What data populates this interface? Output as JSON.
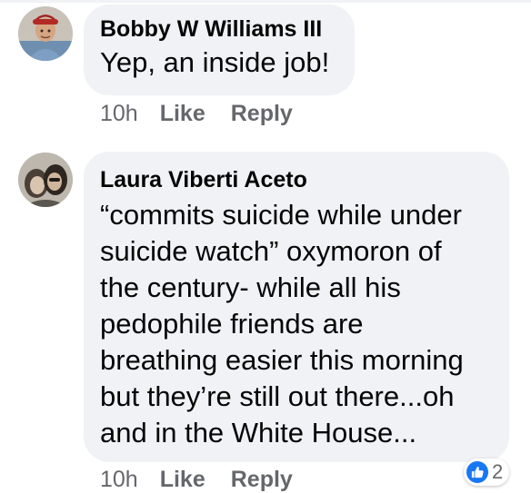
{
  "comments": [
    {
      "author": "Bobby W Williams III",
      "text": "Yep, an inside job!",
      "time": "10h",
      "like_label": "Like",
      "reply_label": "Reply",
      "avatar": "avatar-photo-man-red-cap"
    },
    {
      "author": "Laura Viberti Aceto",
      "text_lines": [
        "“commits suicide while under",
        "suicide watch” oxymoron of",
        "the century- while all his",
        "pedophile friends are",
        "breathing easier this morning",
        "but they’re still out there...oh",
        "and in the White House..."
      ],
      "time": "10h",
      "like_label": "Like",
      "reply_label": "Reply",
      "avatar": "avatar-photo-two-women",
      "reactions": {
        "count": "2",
        "icon": "thumbs-up-icon",
        "color": "#1877f2"
      }
    }
  ],
  "colors": {
    "bubble_bg": "#f0f2f5",
    "meta_text": "#65676b",
    "name_text": "#050505"
  }
}
